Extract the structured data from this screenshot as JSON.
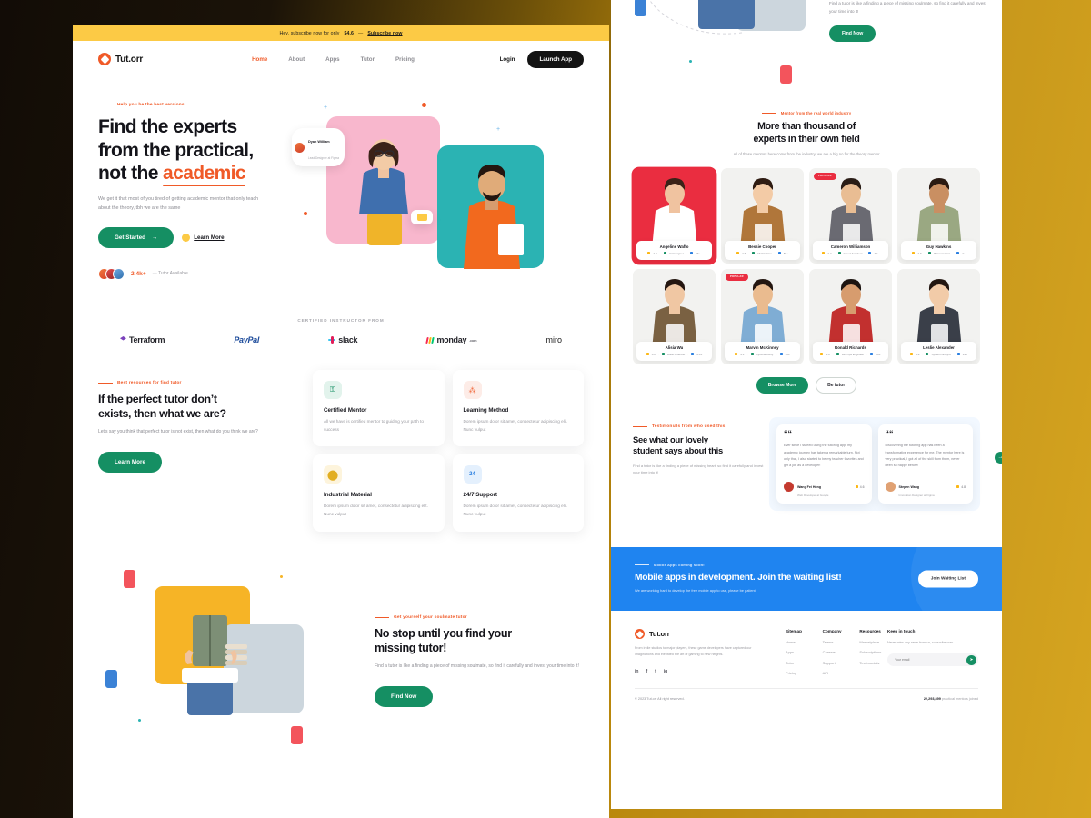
{
  "announcement": {
    "text": "Hey, subscribe now for only",
    "price": "$4.6",
    "dash": "—",
    "link": "Subscribe now"
  },
  "nav": {
    "brand": "Tut.orr",
    "links": [
      "Home",
      "About",
      "Apps",
      "Tutor",
      "Pricing"
    ],
    "login": "Login",
    "launch": "Launch App"
  },
  "hero": {
    "eyebrow": "Help you be the best versions",
    "title_line1": "Find the experts",
    "title_line2": "from the practical,",
    "title_line3_pre": "not the ",
    "title_line3_hl": "academic",
    "subtitle": "We get it that most of you tired of getting academic mentor that only teach about the theory, tbh we are the same",
    "cta_primary": "Get Started",
    "cta_arrow": "→",
    "cta_secondary": "Learn More",
    "avail_count": "2,4k+",
    "avail_label": "Tutor Available",
    "chip_name": "Dyah William",
    "chip_role": "Lead Designer at Figma"
  },
  "logos": {
    "title": "CERTIFIED INSTRUCTOR FROM",
    "items": [
      "Terraform",
      "PayPal",
      "slack",
      "monday",
      "miro"
    ],
    "monday_suffix": ".com"
  },
  "features": {
    "eyebrow": "Best resources for find tutor",
    "title_line1": "If the perfect tutor don’t",
    "title_line2": "exists, then what we are?",
    "subtitle": "Let’s say you think that perfect tutor is not exist, then what do you think we are?",
    "cta": "Learn More",
    "cards": [
      {
        "icon": "lock-icon",
        "glyph": "⚿",
        "title": "Certified Mentor",
        "desc": "All we have is certified mentor to guiding your path to success",
        "tone": "green"
      },
      {
        "icon": "bubbles-icon",
        "glyph": "⁂",
        "title": "Learning Method",
        "desc": "Dorem ipsum dolor sit amet, consectetur adipiscing elit. Nunc vulput",
        "tone": "red"
      },
      {
        "icon": "globe-icon",
        "glyph": "⬤",
        "title": "Industrial Material",
        "desc": "Dorem ipsum dolor sit amet, consectetur adipiscing elit. Nunc vulput",
        "tone": "yellow"
      },
      {
        "icon": "support-icon",
        "glyph": "24",
        "title": "24/7 Support",
        "desc": "Dorem ipsum dolor sit amet, consectetur adipiscing elit. Nunc vulput",
        "tone": "blue"
      }
    ]
  },
  "missing": {
    "eyebrow": "Get yourself your soulmate tutor",
    "title_line1": "No stop until you find your",
    "title_line2": "missing tutor!",
    "subtitle": "Find a tutor is like a finding a piece of missing soulmate, so find it carefully and invest your time into it!",
    "cta": "Find Now"
  },
  "right_top": {
    "subtitle": "Find a tutor is like a finding a piece of missing soulmate, so find it carefully and invest your time into it!",
    "cta": "Find Now"
  },
  "experts": {
    "eyebrow": "Mentor from the real world industry",
    "title_line1": "More than thousand of",
    "title_line2": "experts in their own field",
    "subtitle": "All of these mentors here come from the industry, we are a big no for the theory mentor",
    "browse": "Browse More",
    "betutor": "Be tutor",
    "popular_badge": "POPULAR",
    "tutors": [
      {
        "name": "Angeline Waffo",
        "rating": "4.9",
        "field": "Ui Designer",
        "students": "4K+",
        "featured": true,
        "popular": false,
        "bg": "#ea2d40",
        "outfit": "#ffffff",
        "hair": "#3b2218",
        "skin": "#f0c3a0"
      },
      {
        "name": "Bessie Cooper",
        "rating": "4.6",
        "field": "Mobile Dev",
        "students": "5k+",
        "featured": false,
        "popular": false,
        "bg": "#f2f2f0",
        "outfit": "#b0763a",
        "hair": "#2f1c12",
        "skin": "#f3cba6"
      },
      {
        "name": "Cameron Williamson",
        "rating": "4.4",
        "field": "Cloud Architect",
        "students": "40+",
        "featured": false,
        "popular": true,
        "bg": "#f2f2f0",
        "outfit": "#6a6a72",
        "hair": "#2a1d16",
        "skin": "#e9bd93"
      },
      {
        "name": "Guy Hawkins",
        "rating": "4.6",
        "field": "IT Consultant",
        "students": "4+",
        "featured": false,
        "popular": false,
        "bg": "#f2f2f0",
        "outfit": "#9aa882",
        "hair": "#2a1a12",
        "skin": "#c98f62"
      },
      {
        "name": "Alisia Wu",
        "rating": "4.2",
        "field": "Data Scientist",
        "students": "4.4+",
        "featured": false,
        "popular": false,
        "bg": "#f2f2f0",
        "outfit": "#7a6142",
        "hair": "#241610",
        "skin": "#f0c7a3"
      },
      {
        "name": "Marvin McKinney",
        "rating": "4.1",
        "field": "Cybersecurity",
        "students": "10+",
        "featured": false,
        "popular": true,
        "bg": "#f2f2f0",
        "outfit": "#7fadd4",
        "hair": "#241610",
        "skin": "#eabb8f"
      },
      {
        "name": "Ronald Richards",
        "rating": "4.0",
        "field": "DevOps Engineer",
        "students": "20+",
        "featured": false,
        "popular": false,
        "bg": "#f2f2f0",
        "outfit": "#c2302f",
        "hair": "#1d1410",
        "skin": "#d79c6e"
      },
      {
        "name": "Leslie Alexander",
        "rating": "4.e",
        "field": "System Analyst",
        "students": "19+",
        "featured": false,
        "popular": false,
        "bg": "#f2f2f0",
        "outfit": "#3a3f49",
        "hair": "#231610",
        "skin": "#f2cba8"
      }
    ]
  },
  "testimonials": {
    "eyebrow": "Testimonials from who used this",
    "title_line1": "See what our lovely",
    "title_line2": "student says about this",
    "subtitle": "Find a tutor is like a finding a piece of missing heart, so find it carefully and invest your time into it!",
    "next_arrow": "→",
    "items": [
      {
        "quote_mark": "“",
        "text": "Ever since I started using the tutoring app, my academic journey has taken a remarkable turn. Not only that, I also started to be my teacher favorites and get a job as a developer!",
        "name": "Wang Fei Hong",
        "role": "Web Developer at Google",
        "rating": "4.6",
        "avatar": "#c43a2f"
      },
      {
        "quote_mark": "“",
        "text": "Discovering the tutoring app has been a transformative experience for me. The mentor here is very practical, I got all of the skill from them, never been so happy before!",
        "name": "Stepen Wang",
        "role": "Innovation Designer at Figma",
        "rating": "4.8",
        "avatar": "#e0a173"
      }
    ]
  },
  "cta_banner": {
    "eyebrow": "Mobile Apps coming soon!",
    "title": "Mobile apps in development. Join the waiting list!",
    "subtitle": "We are working hard to develop the free mobile app to use, please be patient!",
    "button": "Join Waiting List"
  },
  "footer": {
    "brand": "Tut.orr",
    "about": "From indie studios to major players, these game developers have captured our imaginations and elevated the art of gaming to new heights.",
    "socials": [
      "in",
      "f",
      "t",
      "ig"
    ],
    "columns": [
      {
        "title": "Sitemap",
        "links": [
          "Home",
          "Apps",
          "Tutor",
          "Pricing"
        ]
      },
      {
        "title": "Company",
        "links": [
          "Teams",
          "Careers",
          "Support",
          "API"
        ]
      },
      {
        "title": "Resources",
        "links": [
          "Marketplace",
          "Subscriptions",
          "Testimonials"
        ]
      }
    ],
    "newsletter": {
      "title": "Keep in touch",
      "desc": "Never miss any news from us, subscribe now",
      "placeholder": "Your email",
      "send_icon": "➤"
    },
    "copyright": "© 2023 Tut.orr All right reserved.",
    "stat_number": "22,293,899",
    "stat_label": "practical mentors joined"
  },
  "colors": {
    "brand_orange": "#f05a28",
    "green": "#158f63",
    "yellow": "#fcca45",
    "blue": "#1f84f0",
    "red": "#ea2d40",
    "dark": "#131313"
  }
}
